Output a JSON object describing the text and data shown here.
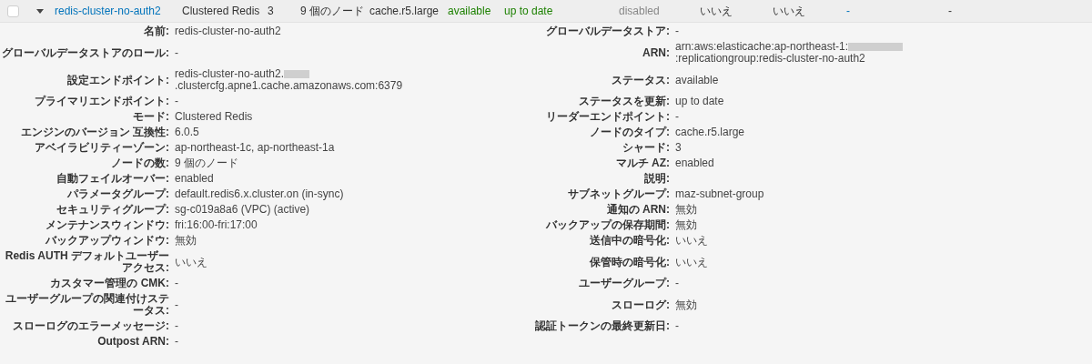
{
  "header_row": {
    "checked": false,
    "expanded": true,
    "cells": [
      {
        "text": "redis-cluster-no-auth2",
        "kind": "link"
      },
      {
        "text": "Clustered Redis",
        "kind": "plain"
      },
      {
        "text": "3",
        "kind": "plain"
      },
      {
        "text": "9 個のノード",
        "kind": "plain"
      },
      {
        "text": "cache.r5.large",
        "kind": "plain"
      },
      {
        "text": "available",
        "kind": "ok"
      },
      {
        "text": "up to date",
        "kind": "ok"
      },
      {
        "text": "disabled",
        "kind": "muted"
      },
      {
        "text": "いいえ",
        "kind": "plain"
      },
      {
        "text": "いいえ",
        "kind": "plain"
      },
      {
        "text": "-",
        "kind": "link"
      },
      {
        "text": "-",
        "kind": "plain"
      }
    ]
  },
  "details": [
    {
      "left": {
        "label": "名前:",
        "value": "redis-cluster-no-auth2"
      },
      "right": {
        "label": "グローバルデータストア:",
        "value": "-"
      }
    },
    {
      "left": {
        "label": "グローバルデータストアのロール:",
        "value": "-"
      },
      "right": {
        "label": "ARN:",
        "value_parts": [
          "arn:aws:elasticache:ap-northeast-1:",
          ":replicationgroup:redis-cluster-no-auth2"
        ]
      }
    },
    {
      "left": {
        "label": "設定エンドポイント:",
        "value_parts": [
          "redis-cluster-no-auth2.",
          ".clustercfg.apne1.cache.amazonaws.com:6379"
        ]
      },
      "right": {
        "label": "ステータス:",
        "value": "available"
      }
    },
    {
      "left": {
        "label": "プライマリエンドポイント:",
        "value": "-"
      },
      "right": {
        "label": "ステータスを更新:",
        "value": "up to date"
      }
    },
    {
      "left": {
        "label": "モード:",
        "value": "Clustered Redis"
      },
      "right": {
        "label": "リーダーエンドポイント:",
        "value": "-"
      }
    },
    {
      "left": {
        "label": "エンジンのバージョン 互換性:",
        "value": "6.0.5"
      },
      "right": {
        "label": "ノードのタイプ:",
        "value": "cache.r5.large"
      }
    },
    {
      "left": {
        "label": "アベイラビリティーゾーン:",
        "value": "ap-northeast-1c, ap-northeast-1a"
      },
      "right": {
        "label": "シャード:",
        "value": "3"
      }
    },
    {
      "left": {
        "label": "ノードの数:",
        "value": "9 個のノード"
      },
      "right": {
        "label": "マルチ AZ:",
        "value": "enabled"
      }
    },
    {
      "left": {
        "label": "自動フェイルオーバー:",
        "value": "enabled"
      },
      "right": {
        "label": "説明:"
      }
    },
    {
      "left": {
        "label": "パラメータグループ:",
        "value": "default.redis6.x.cluster.on (in-sync)"
      },
      "right": {
        "label": "サブネットグループ:",
        "value": "maz-subnet-group"
      }
    },
    {
      "left": {
        "label": "セキュリティグループ:",
        "value": "sg-c019a8a6 (VPC) (active)"
      },
      "right": {
        "label": "通知の ARN:",
        "value": "無効"
      }
    },
    {
      "left": {
        "label": "メンテナンスウィンドウ:",
        "value": "fri:16:00-fri:17:00"
      },
      "right": {
        "label": "バックアップの保存期間:",
        "value": "無効"
      }
    },
    {
      "left": {
        "label": "バックアップウィンドウ:",
        "value": "無効"
      },
      "right": {
        "label": "送信中の暗号化:",
        "value": "いいえ"
      }
    },
    {
      "left": {
        "label": "Redis AUTH デフォルトユーザーアクセス:",
        "value": "いいえ"
      },
      "right": {
        "label": "保管時の暗号化:",
        "value": "いいえ"
      }
    },
    {
      "left": {
        "label": "カスタマー管理の CMK:",
        "value": "-"
      },
      "right": {
        "label": "ユーザーグループ:",
        "value": "-"
      }
    },
    {
      "left": {
        "label": "ユーザーグループの関連付けステータス:",
        "value": "-"
      },
      "right": {
        "label": "スローログ:",
        "value": "無効"
      }
    },
    {
      "left": {
        "label": "スローログのエラーメッセージ:",
        "value": "-"
      },
      "right": {
        "label": "認証トークンの最終更新日:",
        "value": "-"
      }
    },
    {
      "left": {
        "label": "Outpost ARN:",
        "value": "-"
      }
    }
  ]
}
